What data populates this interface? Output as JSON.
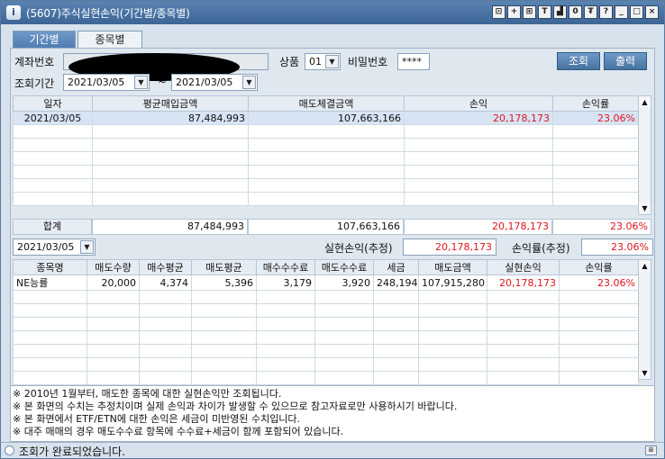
{
  "window": {
    "title": "(5607)주식실현손익(기간별/종목별)",
    "title_buttons": [
      "⊡",
      "+",
      "⊞",
      "T",
      "▟",
      "0",
      "₮",
      "?",
      "_",
      "□",
      "×"
    ]
  },
  "tabs": [
    {
      "label": "기간별",
      "active": true
    },
    {
      "label": "종목별",
      "active": false
    }
  ],
  "form": {
    "account_label": "계좌번호",
    "product_label": "상품",
    "product_value": "01",
    "password_label": "비밀번호",
    "password_value": "****",
    "period_label": "조회기간",
    "date_from": "2021/03/05",
    "tilde": "~",
    "date_to": "2021/03/05",
    "query_button": "조회",
    "print_button": "출력"
  },
  "period_table": {
    "columns": [
      "일자",
      "평균매입금액",
      "매도체결금액",
      "손익",
      "손익률"
    ],
    "rows": [
      [
        "2021/03/05",
        "87,484,993",
        "107,663,166",
        "20,178,173",
        "23.06%"
      ]
    ],
    "empty_rows": 6,
    "total": {
      "label": "합계",
      "values": [
        "87,484,993",
        "107,663,166",
        "20,178,173",
        "23.06%"
      ]
    }
  },
  "realized": {
    "date": "2021/03/05",
    "pl_label": "실현손익(추정)",
    "pl_value": "20,178,173",
    "rate_label": "손익률(추정)",
    "rate_value": "23.06%"
  },
  "stock_table": {
    "columns": [
      "종목명",
      "매도수량",
      "매수평균",
      "매도평균",
      "매수수수료",
      "매도수수료",
      "세금",
      "매도금액",
      "실현손익",
      "손익률"
    ],
    "rows": [
      [
        "NE능률",
        "20,000",
        "4,374",
        "5,396",
        "3,179",
        "3,920",
        "248,194",
        "107,915,280",
        "20,178,173",
        "23.06%"
      ]
    ],
    "empty_rows": 6
  },
  "notes": [
    "※ 2010년 1월부터, 매도한 종목에 대한 실현손익만 조회됩니다.",
    "※ 본 화면의 수치는 추정치이며 실제 손익과 차이가 발생할 수 있으므로 참고자료로만 사용하시기 바랍니다.",
    "※ 본 화면에서 ETF/ETN에 대한 손익은 세금이 미반영된 수치입니다.",
    "※ 대주 매매의 경우 매도수수료 항목에 수수료+세금이 함께 포함되어 있습니다."
  ],
  "status": {
    "message": "조회가 완료되었습니다."
  },
  "colors": {
    "loss_profit_text": "#e0141e",
    "titlebar": "#3c6596",
    "selected_row": "#d7e4f4"
  }
}
